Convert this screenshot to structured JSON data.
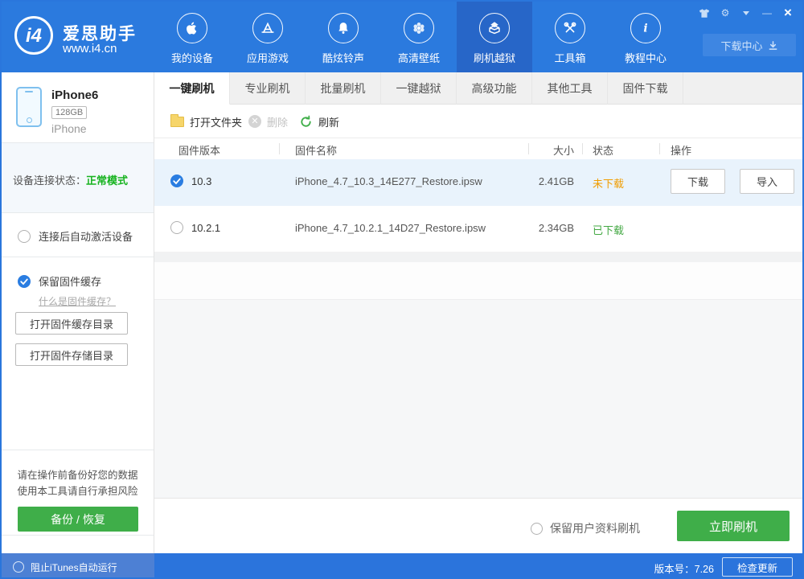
{
  "colors": {
    "accent_blue": "#2b7ade",
    "nav_active_blue": "#2766c8",
    "button_green": "#3fae49",
    "status_normal_green": "#17b31f",
    "status_downloaded_green": "#43a843",
    "status_not_downloaded_orange": "#f09c00",
    "selected_row_blue": "#e9f3fc"
  },
  "brand": {
    "logo": "i4",
    "name": "爱思助手",
    "site": "www.i4.cn"
  },
  "titlebar": {
    "download_center": "下载中心",
    "window_icons": [
      "shirt-skin",
      "settings-gear",
      "dropdown-arrow",
      "minimize",
      "close"
    ],
    "minimize_glyph": "—",
    "close_glyph": "×",
    "gear_glyph": "⚙"
  },
  "nav": {
    "items": [
      {
        "label": "我的设备",
        "icon": "apple",
        "active": false
      },
      {
        "label": "应用游戏",
        "icon": "appstore",
        "active": false
      },
      {
        "label": "酷炫铃声",
        "icon": "bell",
        "active": false
      },
      {
        "label": "高清壁纸",
        "icon": "flower",
        "active": false
      },
      {
        "label": "刷机越狱",
        "icon": "jailbreak-box",
        "active": true
      },
      {
        "label": "工具箱",
        "icon": "toolbox",
        "active": false
      },
      {
        "label": "教程中心",
        "icon": "info",
        "active": false
      }
    ]
  },
  "sidebar": {
    "device": {
      "name": "iPhone6",
      "capacity": "128GB",
      "type": "iPhone"
    },
    "connection": {
      "label": "设备连接状态：",
      "value": "正常模式"
    },
    "auto_activate": {
      "label": "连接后自动激活设备",
      "checked": false
    },
    "keep_cache": {
      "label": "保留固件缓存",
      "checked": true,
      "help_link": "什么是固件缓存？"
    },
    "open_cache_dir": "打开固件缓存目录",
    "open_storage_dir": "打开固件存储目录",
    "warning_line1": "请在操作前备份好您的数据",
    "warning_line2": "使用本工具请自行承担风险",
    "backup_button": "备份 / 恢复"
  },
  "tabs": {
    "active_index": 0,
    "items": [
      "一键刷机",
      "专业刷机",
      "批量刷机",
      "一键越狱",
      "高级功能",
      "其他工具",
      "固件下载"
    ]
  },
  "toolbar": {
    "open_folder": "打开文件夹",
    "delete": "删除",
    "delete_glyph": "✕",
    "refresh": "刷新"
  },
  "firmware_table": {
    "columns": [
      "固件版本",
      "固件名称",
      "大小",
      "状态",
      "操作"
    ],
    "rows": [
      {
        "selected": true,
        "version": "10.3",
        "filename": "iPhone_4.7_10.3_14E277_Restore.ipsw",
        "size": "2.41GB",
        "status": "未下载",
        "download_button": "下载",
        "import_button": "导入"
      },
      {
        "selected": false,
        "version": "10.2.1",
        "filename": "iPhone_4.7_10.2.1_14D27_Restore.ipsw",
        "size": "2.34GB",
        "status": "已下载"
      }
    ]
  },
  "action_bar": {
    "keep_user_data": "保留用户资料刷机",
    "flash_now": "立即刷机"
  },
  "statusbar": {
    "block_itunes": "阻止iTunes自动运行",
    "version": "版本号：7.26",
    "check_update": "检查更新"
  }
}
